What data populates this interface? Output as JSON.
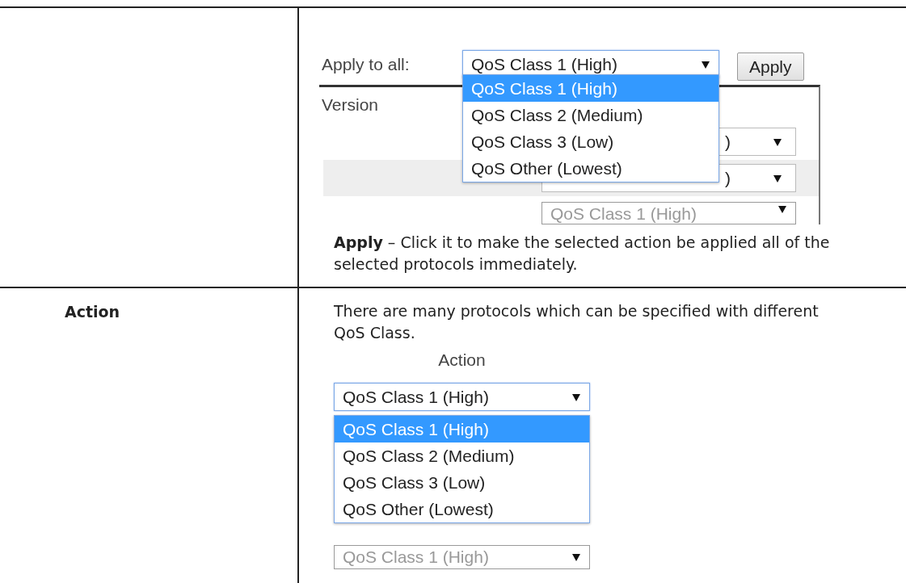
{
  "rows": [
    {
      "label": "",
      "figure": {
        "kind": "apply_all",
        "label": "Apply to all:",
        "select_value": "QoS Class 1 (High)",
        "options": [
          {
            "text": "QoS Class 1 (High)",
            "selected": true
          },
          {
            "text": "QoS Class 2 (Medium)",
            "selected": false
          },
          {
            "text": "QoS Class 3 (Low)",
            "selected": false
          },
          {
            "text": "QoS Other (Lowest)",
            "selected": false
          }
        ],
        "button": "Apply",
        "column_header": "Version",
        "hidden_values": [
          ")",
          ")"
        ],
        "faded_value": "QoS Class 1 (High)"
      },
      "description": "**Apply** – Click it to make the selected action be applied all of the selected protocols immediately."
    },
    {
      "label": "Action",
      "description": "There are many protocols which can be specified with different QoS Class.",
      "figure": {
        "kind": "action_column",
        "column_header": "Action",
        "select_value": "QoS Class 1 (High)",
        "options": [
          {
            "text": "QoS Class 1 (High)",
            "selected": true
          },
          {
            "text": "QoS Class 2 (Medium)",
            "selected": false
          },
          {
            "text": "QoS Class 3 (Low)",
            "selected": false
          },
          {
            "text": "QoS Other (Lowest)",
            "selected": false
          }
        ],
        "faded_value": "QoS Class 1 (High)"
      }
    }
  ]
}
